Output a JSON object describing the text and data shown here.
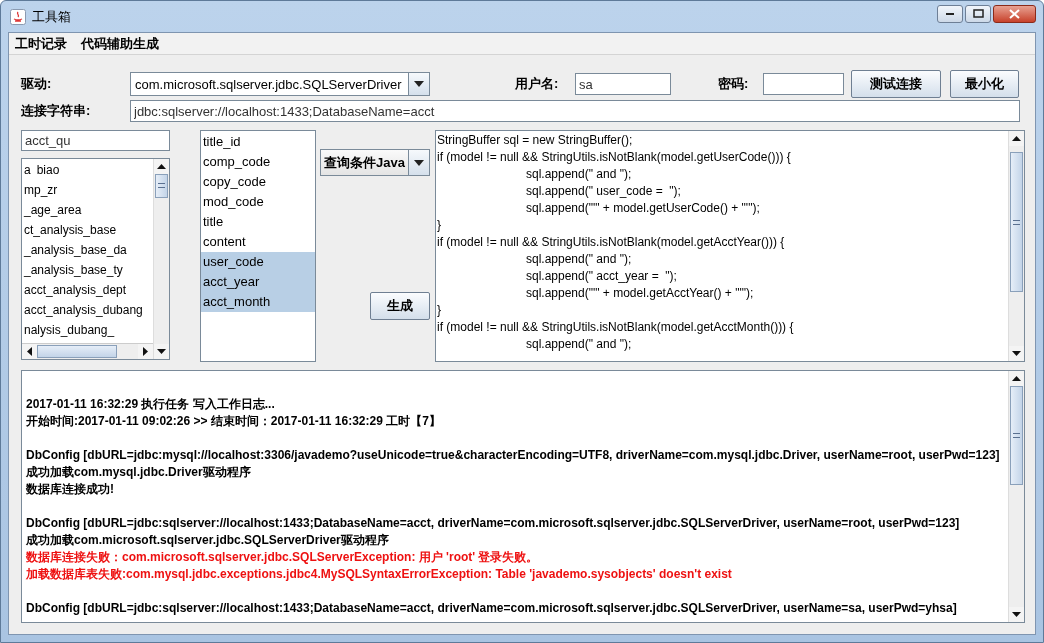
{
  "window": {
    "title": "工具箱"
  },
  "menu": [
    "工时记录",
    "代码辅助生成"
  ],
  "connection": {
    "driver_label": "驱动:",
    "driver": "com.microsoft.sqlserver.jdbc.SQLServerDriver",
    "user_label": "用户名:",
    "user": "sa",
    "password_label": "密码:",
    "test_button": "测试连接",
    "minimize_button": "最小化",
    "url_label": "连接字符串:",
    "url": "jdbc:sqlserver://localhost:1433;DatabaseName=acct"
  },
  "table_filter": {
    "value": "acct_qu"
  },
  "tables": [
    {
      "head": "a",
      "text": "biao"
    },
    {
      "text": "mp_zr"
    },
    {
      "text": "_age_area"
    },
    {
      "text": "ct_analysis_base"
    },
    {
      "text": "_analysis_base_da"
    },
    {
      "text": "_analysis_base_ty"
    },
    {
      "text": "acct_analysis_dept"
    },
    {
      "text": "acct_analysis_dubang"
    },
    {
      "text": "nalysis_dubang_"
    }
  ],
  "columns": [
    {
      "label": "title_id",
      "selected": false
    },
    {
      "label": "comp_code",
      "selected": false
    },
    {
      "label": "copy_code",
      "selected": false
    },
    {
      "label": "mod_code",
      "selected": false
    },
    {
      "label": "title",
      "selected": false
    },
    {
      "label": "content",
      "selected": false
    },
    {
      "label": "user_code",
      "selected": true
    },
    {
      "label": "acct_year",
      "selected": true
    },
    {
      "label": "acct_month",
      "selected": true
    }
  ],
  "template": "查询条件Java",
  "generate_button": "生成",
  "code": [
    {
      "text": "StringBuffer sql = new StringBuffer();",
      "kind": "plain"
    },
    {
      "text": "if (model != null && StringUtils.isNotBlank(model.getUserCode())) {",
      "kind": "plain"
    },
    {
      "text": "sql.append(\" and \");",
      "kind": "indented"
    },
    {
      "text": "sql.append(\" user_code =  \");",
      "kind": "indented"
    },
    {
      "text": "sql.append(\"'\" + model.getUserCode() + \"'\");",
      "kind": "indented"
    },
    {
      "text": "}",
      "kind": "plain"
    },
    {
      "text": "if (model != null && StringUtils.isNotBlank(model.getAcctYear())) {",
      "kind": "plain"
    },
    {
      "text": "sql.append(\" and \");",
      "kind": "indented"
    },
    {
      "text": "sql.append(\" acct_year =  \");",
      "kind": "indented"
    },
    {
      "text": "sql.append(\"'\" + model.getAcctYear() + \"'\");",
      "kind": "indented"
    },
    {
      "text": "}",
      "kind": "plain"
    },
    {
      "text": "if (model != null && StringUtils.isNotBlank(model.getAcctMonth())) {",
      "kind": "plain"
    },
    {
      "text": "sql.append(\" and \");",
      "kind": "indented"
    }
  ],
  "log": [
    {
      "lines": [
        {
          "text": "2017-01-11 16:32:29 执行任务 写入工作日志...",
          "kind": "normal"
        },
        {
          "text": "开始时间:2017-01-11 09:02:26 >> 结束时间：2017-01-11 16:32:29 工时【7】",
          "kind": "normal"
        }
      ]
    },
    {
      "lines": [
        {
          "text": "DbConfig [dbURL=jdbc:mysql://localhost:3306/javademo?useUnicode=true&characterEncoding=UTF8, driverName=com.mysql.jdbc.Driver, userName=root, userPwd=123]",
          "kind": "normal"
        },
        {
          "text": "成功加载com.mysql.jdbc.Driver驱动程序",
          "kind": "normal"
        },
        {
          "text": "数据库连接成功!",
          "kind": "normal"
        }
      ]
    },
    {
      "lines": [
        {
          "text": "DbConfig [dbURL=jdbc:sqlserver://localhost:1433;DatabaseName=acct, driverName=com.microsoft.sqlserver.jdbc.SQLServerDriver, userName=root, userPwd=123]",
          "kind": "normal"
        },
        {
          "text": "成功加载com.microsoft.sqlserver.jdbc.SQLServerDriver驱动程序",
          "kind": "normal"
        },
        {
          "text": "数据库连接失败：com.microsoft.sqlserver.jdbc.SQLServerException: 用户 'root' 登录失败。",
          "kind": "error"
        },
        {
          "text": "加载数据库表失败:com.mysql.jdbc.exceptions.jdbc4.MySQLSyntaxErrorException: Table 'javademo.sysobjects' doesn't exist",
          "kind": "error"
        }
      ]
    },
    {
      "lines": [
        {
          "text": "DbConfig [dbURL=jdbc:sqlserver://localhost:1433;DatabaseName=acct, driverName=com.microsoft.sqlserver.jdbc.SQLServerDriver, userName=sa, userPwd=yhsa]",
          "kind": "normal"
        }
      ]
    }
  ]
}
